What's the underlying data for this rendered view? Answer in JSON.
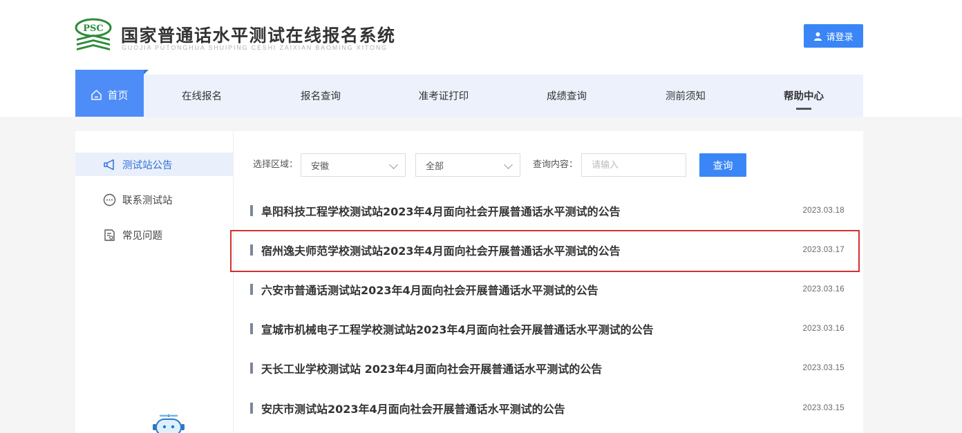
{
  "header": {
    "logo_text": "PSC",
    "title": "国家普通话水平测试在线报名系统",
    "subtitle": "GUOJIA PUTONGHUA SHUIPING CESHI ZAIXIAN BAOMING XITONG",
    "login_label": "请登录"
  },
  "nav": {
    "home": "首页",
    "items": [
      "在线报名",
      "报名查询",
      "准考证打印",
      "成绩查询",
      "测前须知",
      "帮助中心"
    ],
    "active": "帮助中心"
  },
  "sidebar": {
    "items": [
      "测试站公告",
      "联系测试站",
      "常见问题"
    ],
    "active": "测试站公告"
  },
  "filters": {
    "region_label": "选择区域：",
    "province_value": "安徽",
    "city_value": "全部",
    "query_label": "查询内容：",
    "query_placeholder": "请输入",
    "query_button": "查询"
  },
  "notices": [
    {
      "title": "阜阳科技工程学校测试站2023年4月面向社会开展普通话水平测试的公告",
      "date": "2023.03.18"
    },
    {
      "title": "宿州逸夫师范学校测试站2023年4月面向社会开展普通话水平测试的公告",
      "date": "2023.03.17"
    },
    {
      "title": "六安市普通话测试站2023年4月面向社会开展普通话水平测试的公告",
      "date": "2023.03.16"
    },
    {
      "title": "宣城市机械电子工程学校测试站2023年4月面向社会开展普通话水平测试的公告",
      "date": "2023.03.16"
    },
    {
      "title": "天长工业学校测试站 2023年4月面向社会开展普通话水平测试的公告",
      "date": "2023.03.15"
    },
    {
      "title": "安庆市测试站2023年4月面向社会开展普通话水平测试的公告",
      "date": "2023.03.15"
    }
  ],
  "colors": {
    "accent": "#3a86f6",
    "nav_bg": "#ecf1fb",
    "highlight_border": "#d32f2f"
  }
}
